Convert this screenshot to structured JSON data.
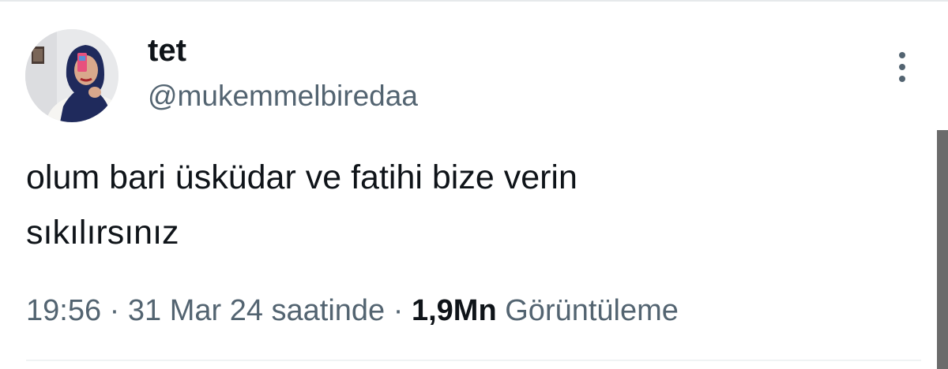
{
  "author": {
    "display_name": "tet",
    "handle": "@mukemmelbiredaa",
    "avatar_icon": "profile-photo-avatar"
  },
  "tweet": {
    "text_line_1": "olum bari üsküdar ve fatihi bize verin",
    "text_line_2": "sıkılırsınız"
  },
  "meta": {
    "time": "19:56",
    "separator": " · ",
    "date": "31 Mar 24 saatinde",
    "views_count": "1,9Mn",
    "views_label": "Görüntüleme"
  },
  "actions": {
    "more_icon": "more-vertical-icon"
  },
  "colors": {
    "text_primary": "#0f1419",
    "text_secondary": "#536471",
    "divider": "#eff3f4"
  }
}
